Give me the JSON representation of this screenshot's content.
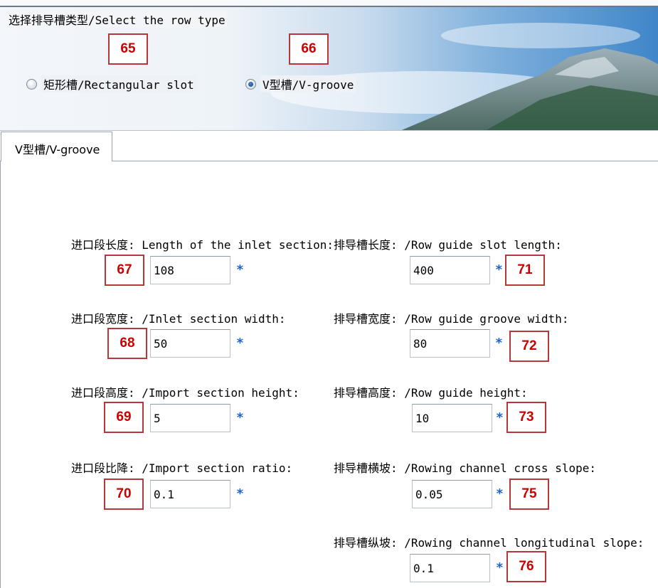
{
  "row_type_group": {
    "title": "选择排导槽类型/Select the row type",
    "options": [
      {
        "label": "矩形槽/Rectangular slot",
        "checked": false
      },
      {
        "label": "V型槽/V-groove",
        "checked": true
      }
    ]
  },
  "tab": {
    "label": "V型槽/V-groove"
  },
  "inlet": {
    "length": {
      "label": "进口段长度: Length of the inlet section:",
      "value": "108"
    },
    "width": {
      "label": "进口段宽度: /Inlet section width:",
      "value": "50"
    },
    "height": {
      "label": "进口段高度: /Import section height:",
      "value": "5"
    },
    "ratio": {
      "label": "进口段比降: /Import section ratio:",
      "value": "0.1"
    }
  },
  "guide": {
    "length": {
      "label": "排导槽长度: /Row guide slot length:",
      "value": "400"
    },
    "width": {
      "label": "排导槽宽度: /Row guide groove width:",
      "value": "80"
    },
    "height": {
      "label": "排导槽高度: /Row guide height:",
      "value": "10"
    },
    "cross_slope": {
      "label": "排导槽横坡: /Rowing channel cross slope:",
      "value": "0.05"
    },
    "long_slope": {
      "label": "排导槽纵坡: /Rowing channel longitudinal slope:",
      "value": "0.1"
    }
  },
  "required_mark": "*",
  "badges": [
    "65",
    "66",
    "67",
    "68",
    "69",
    "70",
    "71",
    "72",
    "73",
    "75",
    "76"
  ]
}
